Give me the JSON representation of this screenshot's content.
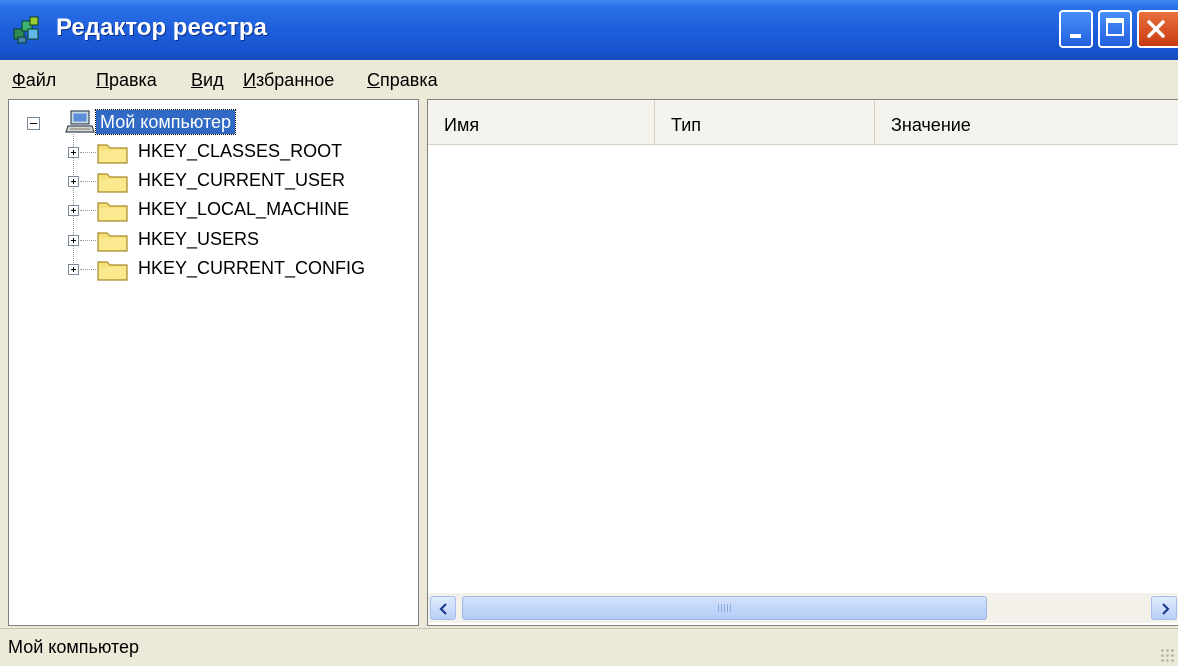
{
  "window": {
    "title": "Редактор реестра",
    "colors": {
      "titlebar": "#1E5FDB",
      "selection": "#316AC5",
      "close_button": "#E0582A"
    }
  },
  "menu": {
    "items": [
      "Файл",
      "Правка",
      "Вид",
      "Избранное",
      "Справка"
    ]
  },
  "tree": {
    "root": {
      "label": "Мой компьютер",
      "icon": "computer-icon",
      "expanded": true,
      "selected": true
    },
    "keys": [
      {
        "label": "HKEY_CLASSES_ROOT",
        "icon": "folder-icon"
      },
      {
        "label": "HKEY_CURRENT_USER",
        "icon": "folder-icon"
      },
      {
        "label": "HKEY_LOCAL_MACHINE",
        "icon": "folder-icon"
      },
      {
        "label": "HKEY_USERS",
        "icon": "folder-icon"
      },
      {
        "label": "HKEY_CURRENT_CONFIG",
        "icon": "folder-icon"
      }
    ]
  },
  "list": {
    "columns": [
      "Имя",
      "Тип",
      "Значение"
    ],
    "rows": []
  },
  "statusbar": {
    "text": "Мой компьютер"
  }
}
